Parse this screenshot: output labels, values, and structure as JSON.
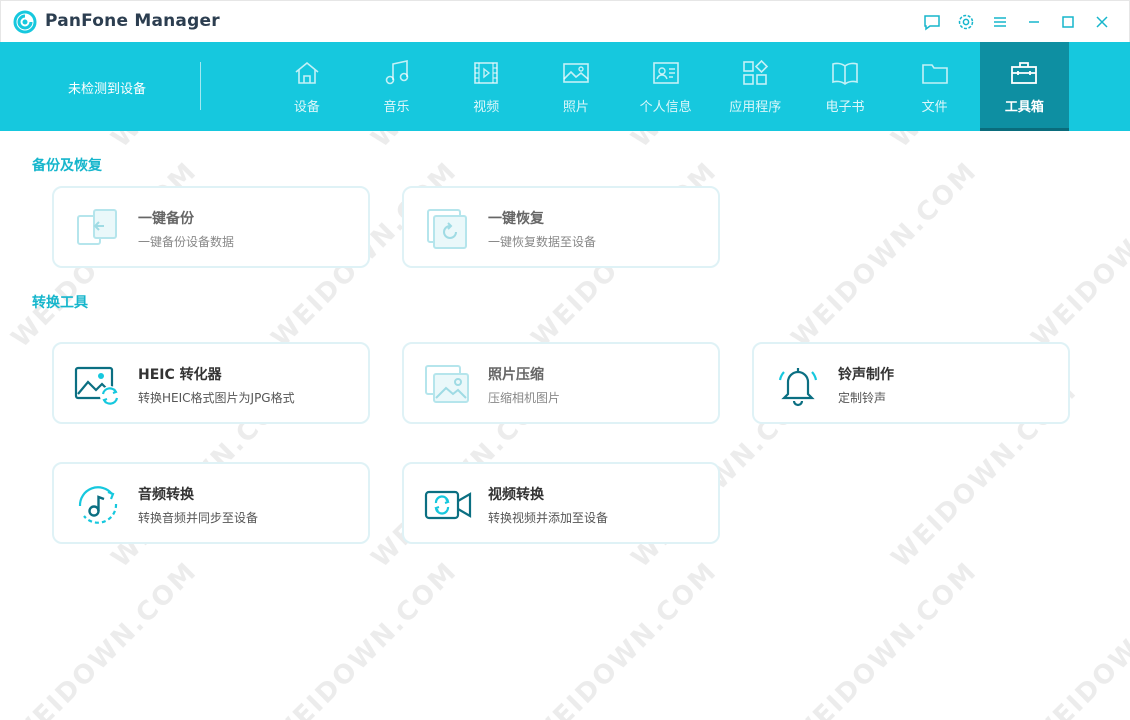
{
  "app": {
    "title": "PanFone Manager",
    "accent": "#16c8de",
    "accent_dark": "#0e8fa2"
  },
  "window_controls": [
    {
      "name": "feedback-icon"
    },
    {
      "name": "settings-icon"
    },
    {
      "name": "menu-icon"
    },
    {
      "name": "minimize-icon"
    },
    {
      "name": "maximize-icon"
    },
    {
      "name": "close-icon"
    }
  ],
  "device": {
    "status": "未检测到设备"
  },
  "nav": {
    "tabs": [
      {
        "label": "设备",
        "icon": "home-icon"
      },
      {
        "label": "音乐",
        "icon": "music-icon"
      },
      {
        "label": "视频",
        "icon": "video-icon"
      },
      {
        "label": "照片",
        "icon": "photo-icon"
      },
      {
        "label": "个人信息",
        "icon": "contact-card-icon"
      },
      {
        "label": "应用程序",
        "icon": "apps-icon"
      },
      {
        "label": "电子书",
        "icon": "book-icon"
      },
      {
        "label": "文件",
        "icon": "folder-icon"
      },
      {
        "label": "工具箱",
        "icon": "toolbox-icon",
        "active": true
      }
    ]
  },
  "sections": {
    "backup": {
      "title": "备份及恢复",
      "cards": [
        {
          "title": "一键备份",
          "desc": "一键备份设备数据",
          "icon": "backup-icon",
          "disabled": true
        },
        {
          "title": "一键恢复",
          "desc": "一键恢复数据至设备",
          "icon": "restore-icon",
          "disabled": true
        }
      ]
    },
    "convert": {
      "title": "转换工具",
      "cards": [
        {
          "title": "HEIC 转化器",
          "desc": "转换HEIC格式图片为JPG格式",
          "icon": "heic-convert-icon"
        },
        {
          "title": "照片压缩",
          "desc": "压缩相机图片",
          "icon": "photo-compress-icon",
          "disabled": true
        },
        {
          "title": "铃声制作",
          "desc": "定制铃声",
          "icon": "bell-icon"
        },
        {
          "title": "音频转换",
          "desc": "转换音频并同步至设备",
          "icon": "audio-convert-icon"
        },
        {
          "title": "视频转换",
          "desc": "转换视频并添加至设备",
          "icon": "video-convert-icon"
        }
      ]
    }
  },
  "watermark": "WEIDOWN.COM"
}
